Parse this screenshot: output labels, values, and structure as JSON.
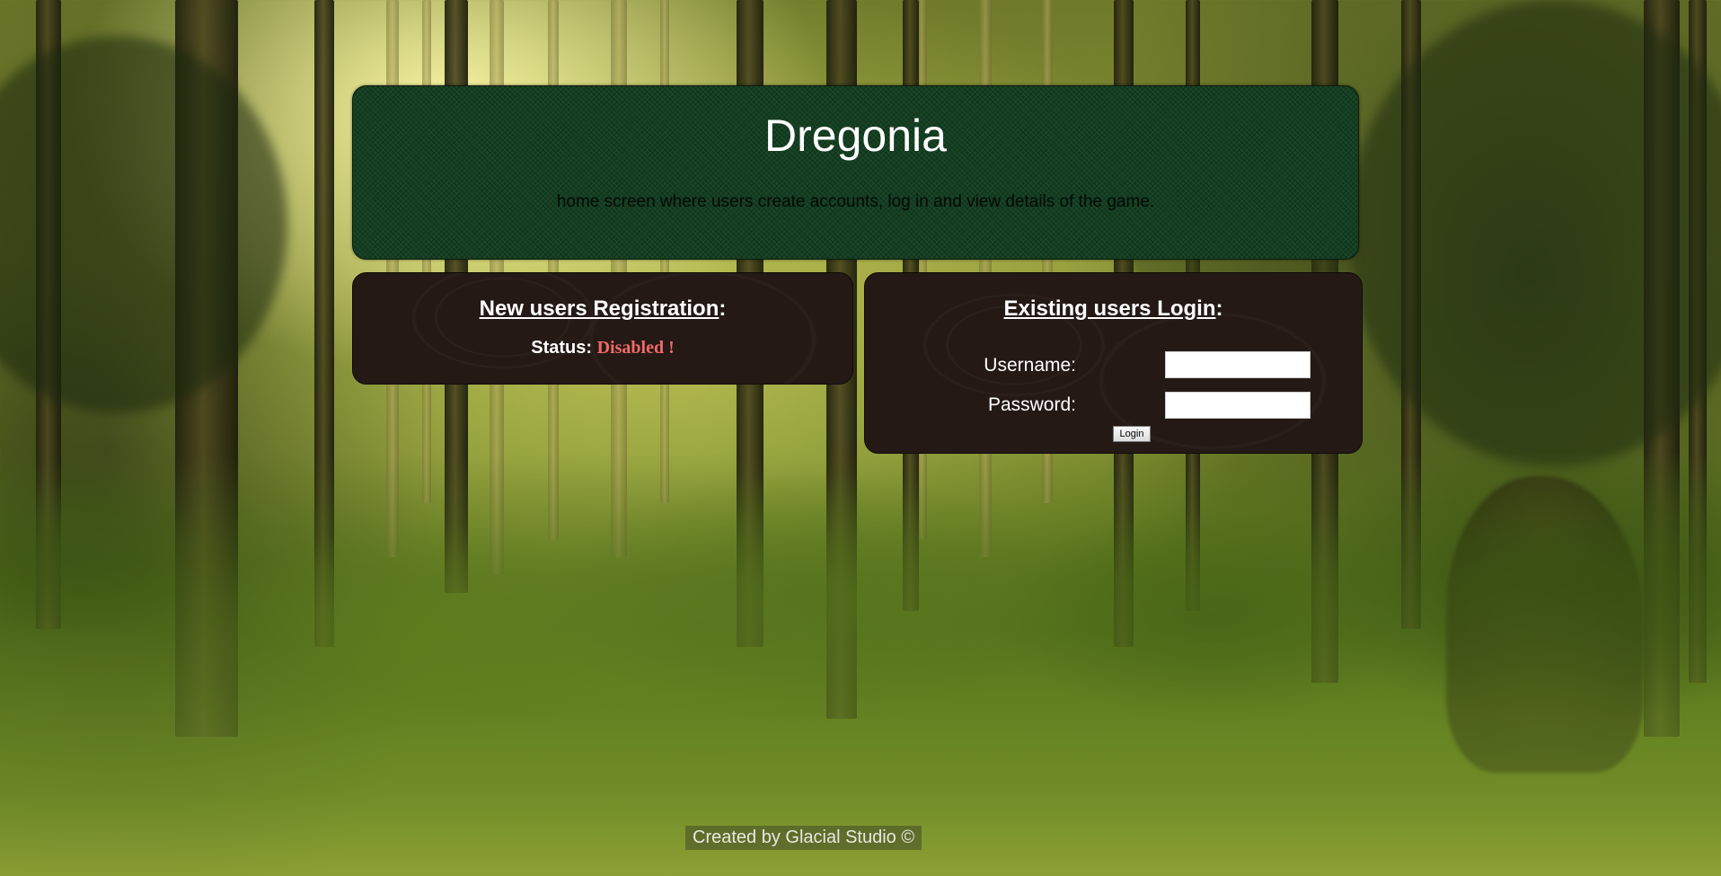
{
  "header": {
    "title": "Dregonia",
    "description": "home screen where users create accounts, log in and view details of the game."
  },
  "registration": {
    "heading": "New users Registration",
    "heading_suffix": ":",
    "status_label": "Status:",
    "status_value": "Disabled !",
    "status_color": "#f06a6a"
  },
  "login": {
    "heading": "Existing users Login",
    "heading_suffix": ":",
    "username_label": "Username:",
    "username_value": "",
    "password_label": "Password:",
    "password_value": "",
    "button_label": "Login"
  },
  "footer": {
    "text": "Created by Glacial Studio ©"
  },
  "colors": {
    "header_panel": "#0f3a1d",
    "box_panel": "#241915"
  }
}
